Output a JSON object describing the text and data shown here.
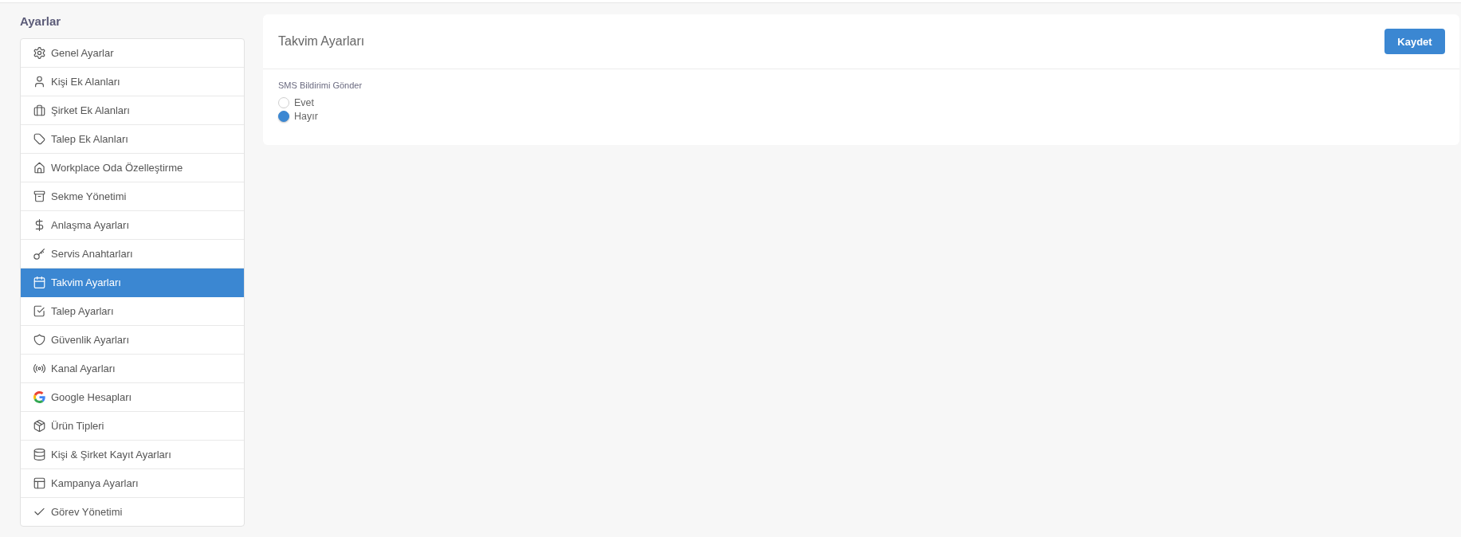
{
  "page_title": "Ayarlar",
  "sidebar": {
    "items": [
      {
        "label": "Genel Ayarlar",
        "selected": false
      },
      {
        "label": "Kişi Ek Alanları",
        "selected": false
      },
      {
        "label": "Şirket Ek Alanları",
        "selected": false
      },
      {
        "label": "Talep Ek Alanları",
        "selected": false
      },
      {
        "label": "Workplace Oda Özelleştirme",
        "selected": false
      },
      {
        "label": "Sekme Yönetimi",
        "selected": false
      },
      {
        "label": "Anlaşma Ayarları",
        "selected": false
      },
      {
        "label": "Servis Anahtarları",
        "selected": false
      },
      {
        "label": "Takvim Ayarları",
        "selected": true
      },
      {
        "label": "Talep Ayarları",
        "selected": false
      },
      {
        "label": "Güvenlik Ayarları",
        "selected": false
      },
      {
        "label": "Kanal Ayarları",
        "selected": false
      },
      {
        "label": "Google Hesapları",
        "selected": false
      },
      {
        "label": "Ürün Tipleri",
        "selected": false
      },
      {
        "label": "Kişi & Şirket Kayıt Ayarları",
        "selected": false
      },
      {
        "label": "Kampanya Ayarları",
        "selected": false
      },
      {
        "label": "Görev Yönetimi",
        "selected": false
      }
    ]
  },
  "panel": {
    "title": "Takvim Ayarları",
    "save_button": "Kaydet",
    "sms_setting": {
      "label": "SMS Bildirimi Gönder",
      "options": [
        {
          "label": "Evet",
          "selected": false
        },
        {
          "label": "Hayır",
          "selected": true
        }
      ]
    }
  }
}
